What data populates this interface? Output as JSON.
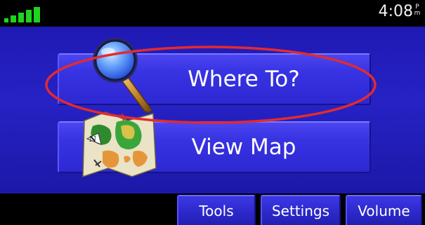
{
  "status": {
    "signal_bars": 5,
    "time": "4:08",
    "ampm": "Pm",
    "signal_icon": "signal-strength-icon"
  },
  "main_menu": {
    "where_to_label": "Where To?",
    "view_map_label": "View Map",
    "where_to_icon": "magnifier-icon",
    "view_map_icon": "folded-map-icon"
  },
  "bottom_bar": {
    "tools_label": "Tools",
    "settings_label": "Settings",
    "volume_label": "Volume"
  },
  "annotation": {
    "highlight_color": "#e32a2f",
    "highlight_icon": "red-ellipse-highlight"
  },
  "colors": {
    "background": "#000000",
    "main_panel": "#2622c4",
    "button": "#3833e2",
    "text": "#ffffff",
    "signal": "#1ed41e"
  }
}
